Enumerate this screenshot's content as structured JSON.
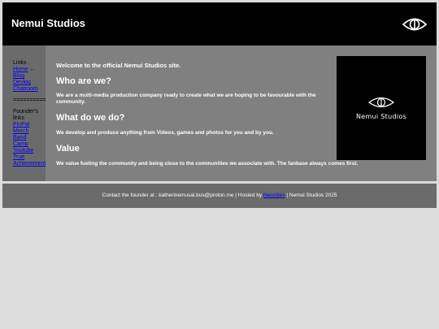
{
  "header": {
    "title": "Nemui Studios",
    "logo_icon": "eye-icon"
  },
  "sidebar": {
    "heading": "Links",
    "home_label": "Home",
    "home_marker": "←",
    "nav_links": [
      "Blog",
      "Devlog",
      "Chatroom"
    ],
    "separator": "==========",
    "founder_heading": "Founder's links",
    "founder_links": [
      "PinPal",
      "Merch",
      "Band",
      "Camp",
      "Youtube",
      "True",
      "Achievements"
    ]
  },
  "main": {
    "welcome": "Welcome to the official Nemui Studios site.",
    "sections": [
      {
        "heading": "Who are we?",
        "text": "We are a multi-media production company ready to create what we are hoping to be favourable with the community."
      },
      {
        "heading": "What do we do?",
        "text": "We develop and produce anything from Videos, games and photos for you and by you."
      },
      {
        "heading": "Value",
        "text": "We value fueling the community and being close to the communities we associate with. The fanbase always comes first."
      }
    ],
    "logo_text": "Nemui Studios"
  },
  "footer": {
    "contact_prefix": "Contact the founder at : katherinemusal.bus@proton.me | Hosted by ",
    "host_link": "Neocities",
    "suffix": " | Nemui Studios 2025"
  },
  "colors": {
    "header_bg": "#000000",
    "sidebar_bg": "#6b6b6b",
    "main_bg": "#808080",
    "page_bg": "#dcdcdc",
    "link": "#0000ee"
  }
}
